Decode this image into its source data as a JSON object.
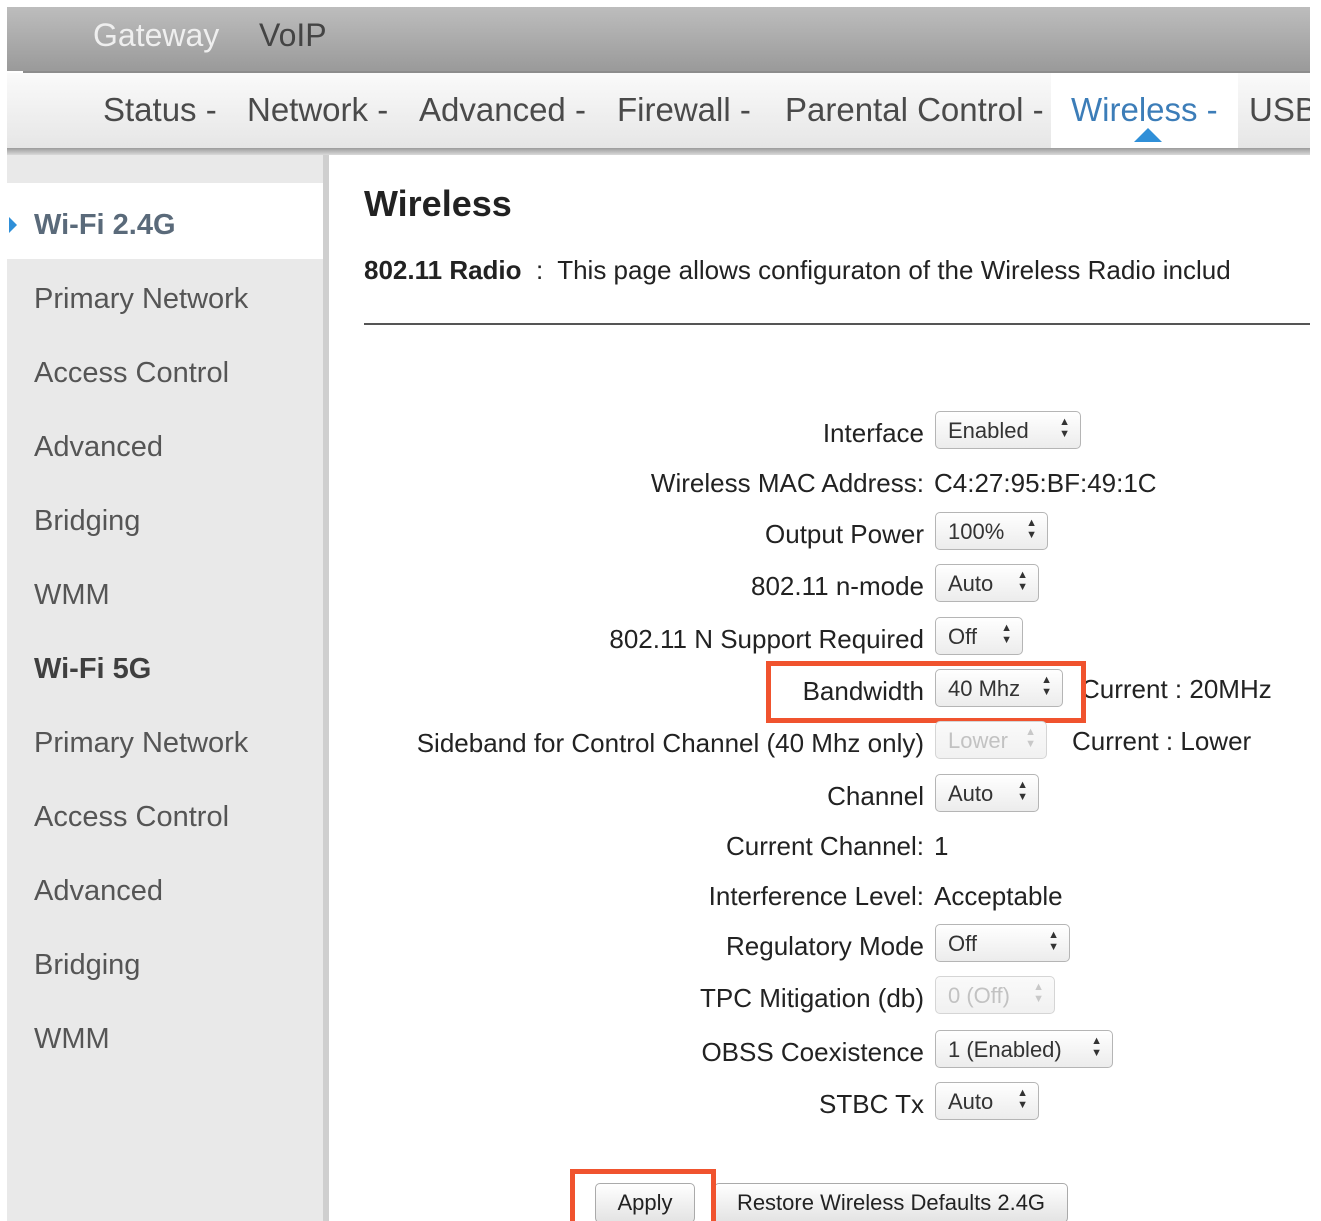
{
  "topnav": {
    "items": [
      "Gateway",
      "VoIP"
    ]
  },
  "mainnav": {
    "tabs": [
      "Status -",
      "Network -",
      "Advanced -",
      "Firewall -",
      "Parental Control -",
      "Wireless -",
      "USB"
    ],
    "active": "Wireless -"
  },
  "sidebar": {
    "groups": [
      {
        "title": "Wi-Fi 2.4G",
        "items": [
          "Primary Network",
          "Access Control",
          "Advanced",
          "Bridging",
          "WMM"
        ]
      },
      {
        "title": "Wi-Fi 5G",
        "items": [
          "Primary Network",
          "Access Control",
          "Advanced",
          "Bridging",
          "WMM"
        ]
      }
    ]
  },
  "page": {
    "title": "Wireless",
    "desc_label": "802.11 Radio",
    "desc_sep": ":",
    "desc_text": "This page allows configuraton of the Wireless Radio includ"
  },
  "form": {
    "interface": {
      "label": "Interface",
      "value": "Enabled"
    },
    "mac": {
      "label": "Wireless MAC Address:",
      "value": "C4:27:95:BF:49:1C"
    },
    "output_power": {
      "label": "Output Power",
      "value": "100%"
    },
    "nmode": {
      "label": "802.11 n-mode",
      "value": "Auto"
    },
    "n_support": {
      "label": "802.11 N Support Required",
      "value": "Off"
    },
    "bandwidth": {
      "label": "Bandwidth",
      "value": "40 Mhz",
      "current": "Current :  20MHz"
    },
    "sideband": {
      "label": "Sideband for Control Channel (40 Mhz only)",
      "value": "Lower",
      "current": "Current : Lower"
    },
    "channel": {
      "label": "Channel",
      "value": "Auto"
    },
    "current_channel": {
      "label": "Current Channel:",
      "value": "1"
    },
    "interference": {
      "label": "Interference Level:",
      "value": "Acceptable"
    },
    "regulatory": {
      "label": "Regulatory Mode",
      "value": "Off"
    },
    "tpc": {
      "label": "TPC Mitigation (db)",
      "value": "0 (Off)"
    },
    "obss": {
      "label": "OBSS Coexistence",
      "value": "1 (Enabled)"
    },
    "stbc": {
      "label": "STBC Tx",
      "value": "Auto"
    }
  },
  "buttons": {
    "apply": "Apply",
    "restore": "Restore Wireless Defaults 2.4G"
  },
  "colors": {
    "accent": "#2f8fd8",
    "highlight": "#f0532e"
  }
}
